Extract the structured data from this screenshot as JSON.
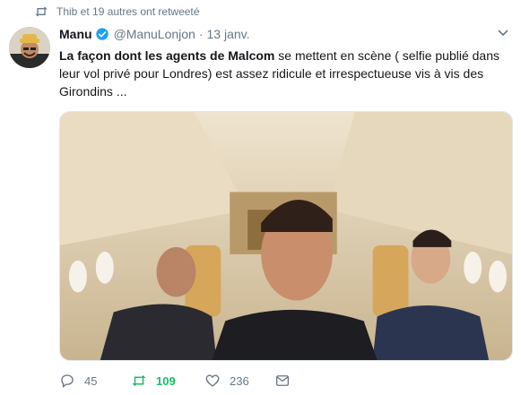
{
  "retweet_context": {
    "text": "Thib et 19 autres ont retweeté",
    "icon": "retweet-icon"
  },
  "tweet": {
    "author_name": "Manu",
    "verified": true,
    "handle": "@ManuLonjon",
    "separator": "·",
    "date": "13 janv.",
    "text_bold": "La façon dont les agents de Malcom",
    "text_rest": " se mettent en scène ( selfie publié dans leur vol privé pour Londres) est assez ridicule et irrespectueuse vis à vis des Girondins ..."
  },
  "actions": {
    "replies": "45",
    "retweets": "109",
    "likes": "236"
  },
  "colors": {
    "accent": "#1da1f2",
    "retweet_active": "#17bf63",
    "muted": "#657786",
    "text": "#14171a"
  }
}
